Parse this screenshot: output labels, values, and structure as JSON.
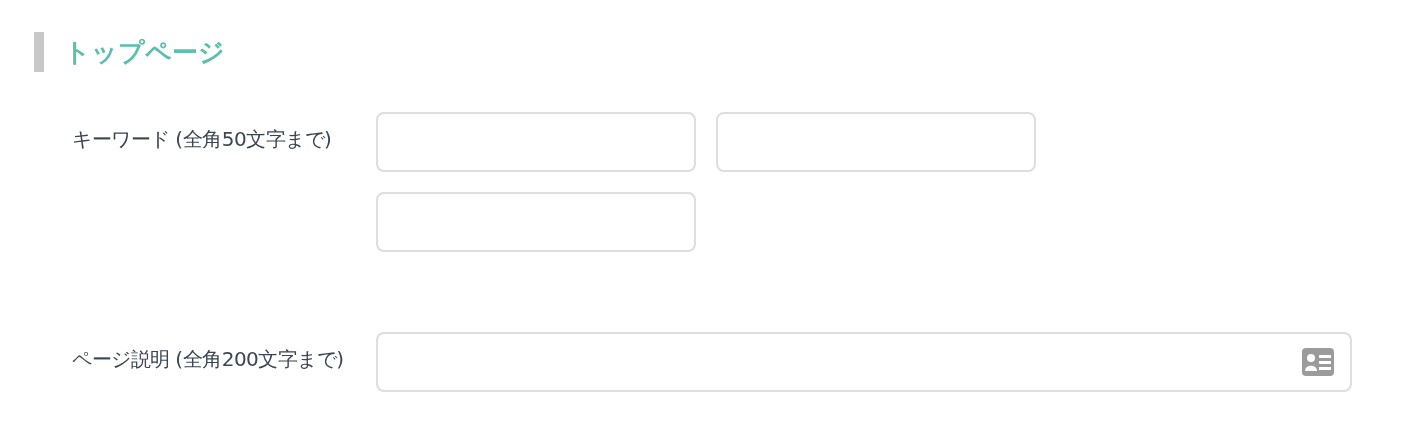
{
  "heading": "トップページ",
  "fields": [
    {
      "kind": "keywords",
      "label": "キーワード (全角50文字まで)",
      "inputs": [
        {
          "kind": "text"
        },
        {
          "kind": "text"
        },
        {
          "kind": "text"
        }
      ]
    },
    {
      "kind": "description",
      "label": "ページ説明 (全角200文字まで)",
      "inputs": [
        {
          "kind": "text-with-card"
        }
      ]
    }
  ]
}
